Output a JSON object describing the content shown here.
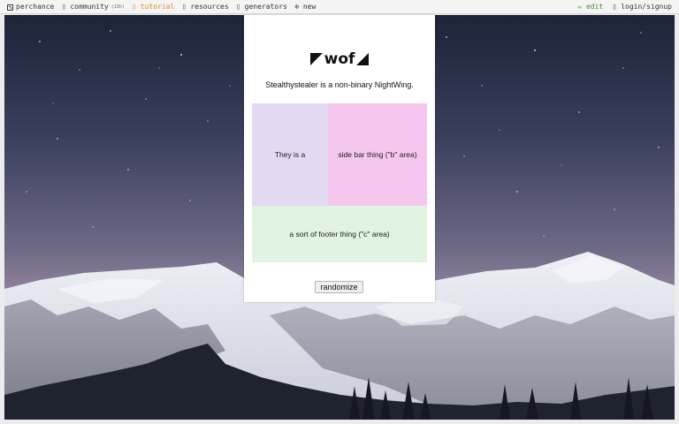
{
  "nav": {
    "left": [
      {
        "icon": "dice-icon",
        "label": "perchance",
        "note": ""
      },
      {
        "icon": "chat-icon",
        "label": "community",
        "note": "(13h)"
      },
      {
        "icon": "book-icon",
        "label": "tutorial",
        "note": ""
      },
      {
        "icon": "info-icon",
        "label": "resources",
        "note": ""
      },
      {
        "icon": "list-icon",
        "label": "generators",
        "note": ""
      },
      {
        "icon": "plus-icon",
        "label": "new",
        "note": ""
      }
    ],
    "right": [
      {
        "icon": "pencil-icon",
        "label": "edit"
      },
      {
        "icon": "user-icon",
        "label": "login/signup"
      }
    ],
    "active_color": "#e08a1e",
    "edit_color": "#3b8e2f"
  },
  "card": {
    "logo_text": "wof",
    "sentence": "Stealthystealer is a non-binary NightWing.",
    "area_a": "They is a",
    "area_b": "side bar thing (\"b\" area)",
    "area_c": "a sort of footer thing (\"c\" area)",
    "button_label": "randomize"
  },
  "colors": {
    "area_a": "#e3d9f2",
    "area_b": "#f5c6f0",
    "area_c": "#e1f4e1"
  }
}
